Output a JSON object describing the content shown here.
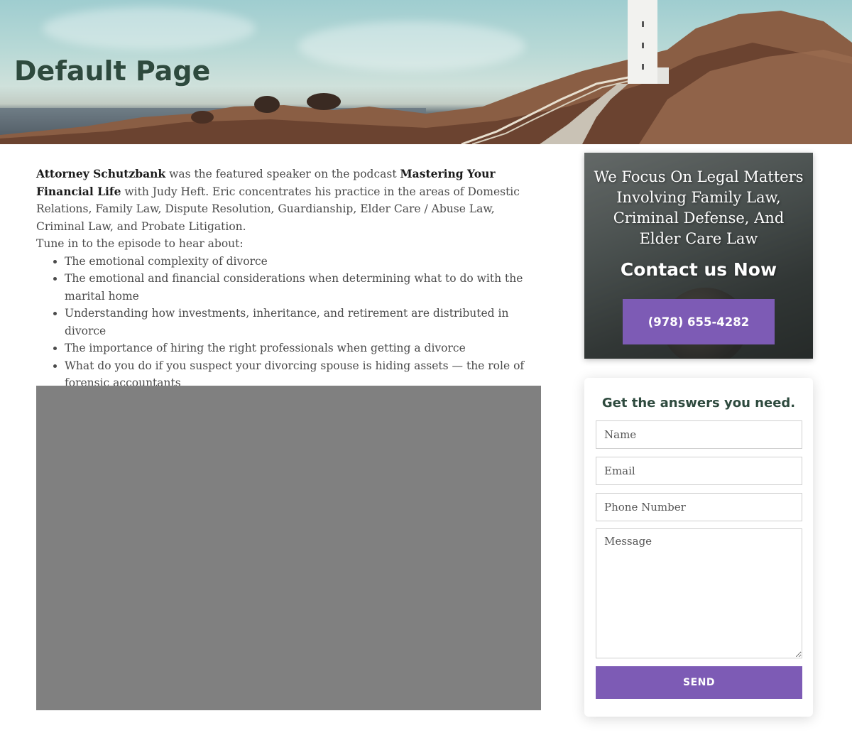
{
  "hero": {
    "title": "Default Page"
  },
  "main": {
    "intro_bold_1": "Attorney Schutzbank",
    "intro_text_1": " was the featured speaker on the podcast ",
    "intro_bold_2": "Mastering Your Financial Life",
    "intro_text_2": " with Judy Heft. Eric concentrates his practice in the areas of Domestic Relations, Family Law, Dispute Resolution, Guardianship, Elder Care / Abuse Law, Criminal Law, and Probate Litigation.",
    "tune_in": "Tune in to the episode to hear about:",
    "topics": [
      "The emotional complexity of divorce",
      "The emotional and financial considerations when determining what to do with the marital home",
      "Understanding how investments, inheritance, and retirement are distributed in divorce",
      "The importance of hiring the right professionals when getting a divorce",
      "What do you do if you suspect your divorcing spouse is hiding assets — the role of forensic accountants"
    ]
  },
  "cta": {
    "heading": "We Focus On Legal Matters Involving Family Law, Criminal Defense, And Elder Care Law",
    "sub": "Contact us Now",
    "phone": "(978) 655-4282"
  },
  "form": {
    "title": "Get the answers you need.",
    "name_placeholder": "Name",
    "email_placeholder": "Email",
    "phone_placeholder": "Phone Number",
    "message_placeholder": "Message",
    "send_label": "SEND"
  },
  "colors": {
    "accent": "#7d5bb5",
    "heading_green": "#2e4a3e",
    "video_gray": "#808080"
  }
}
